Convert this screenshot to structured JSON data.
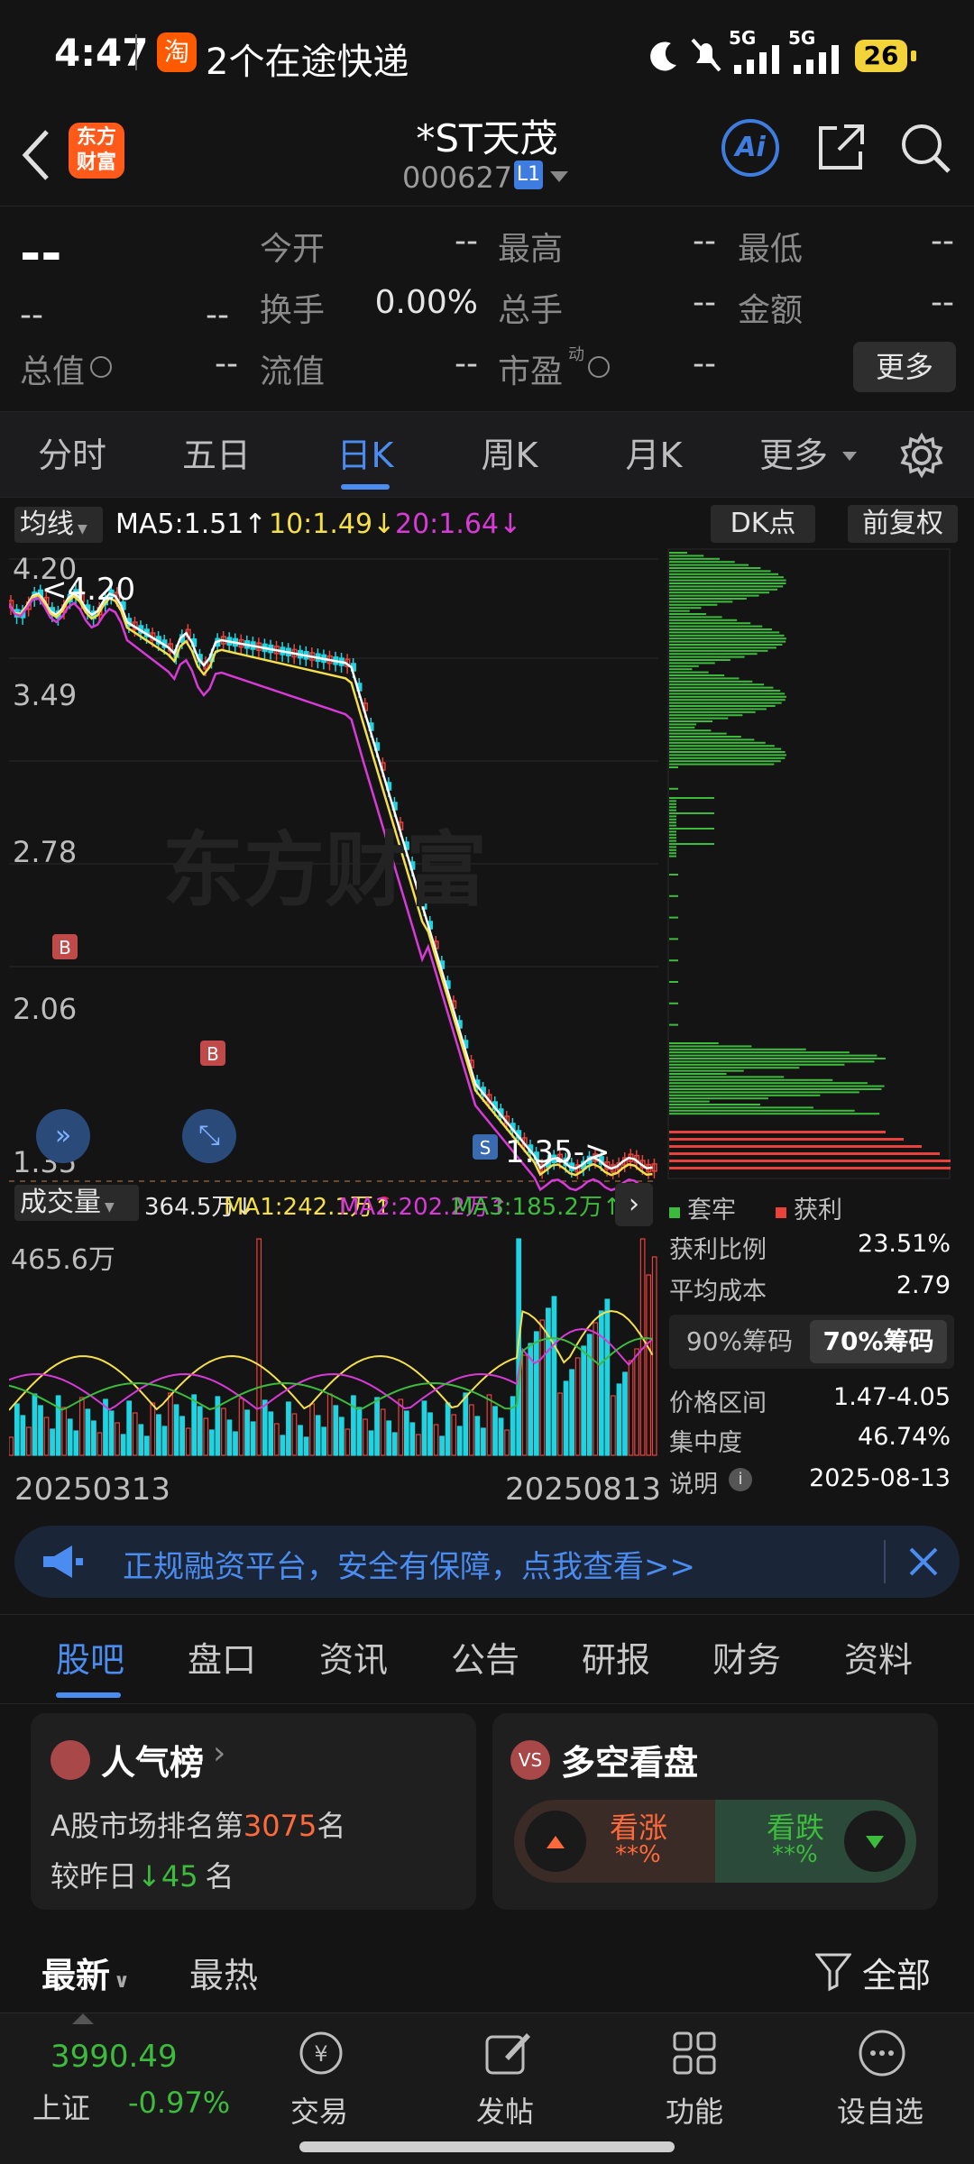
{
  "status": {
    "time": "4:47",
    "notification": "2个在途快递",
    "taobao_badge": "淘",
    "signal1": "5G",
    "signal2": "5G",
    "battery": "26"
  },
  "nav": {
    "logo_line1": "东方",
    "logo_line2": "财富",
    "stock_name": "*ST天茂",
    "stock_code": "000627",
    "level": "L1",
    "ai": "Ai"
  },
  "quote": {
    "price": "--",
    "chg": "--",
    "chg_pct": "--",
    "fields": [
      {
        "label": "今开",
        "value": "--"
      },
      {
        "label": "最高",
        "value": "--"
      },
      {
        "label": "最低",
        "value": "--"
      },
      {
        "label": "换手",
        "value": "0.00%"
      },
      {
        "label": "总手",
        "value": "--"
      },
      {
        "label": "金额",
        "value": "--"
      },
      {
        "label": "总值",
        "value": "--"
      },
      {
        "label": "流值",
        "value": "--"
      },
      {
        "label": "市盈",
        "value": "--"
      }
    ],
    "pe_sup": "动",
    "more": "更多"
  },
  "ktabs": [
    "分时",
    "五日",
    "日K",
    "周K",
    "月K",
    "更多"
  ],
  "ma": {
    "selector": "均线",
    "ma5": "MA5:1.51",
    "ma10": "10:1.49",
    "ma20": "20:1.64",
    "dk": "DK点",
    "fq": "前复权"
  },
  "price_axis": [
    "4.20",
    "3.49",
    "2.78",
    "2.06",
    "1.35"
  ],
  "max_label": "<4.20",
  "min_label": "1.35->",
  "watermark": "东方财富",
  "vol": {
    "selector": "成交量",
    "value": "364.5万",
    "ma1": "MA1:242.1万",
    "ma2": "MA2:202.2万",
    "ma3": "MA3:185.2万",
    "max": "465.6万",
    "date_start": "20250313",
    "date_end": "20250813"
  },
  "chips": {
    "legend_trap": "套牢",
    "legend_profit": "获利",
    "rows": [
      {
        "label": "获利比例",
        "value": "23.51%"
      },
      {
        "label": "平均成本",
        "value": "2.79"
      }
    ],
    "btn90": "90%筹码",
    "btn70": "70%筹码",
    "rows2": [
      {
        "label": "价格区间",
        "value": "1.47-4.05"
      },
      {
        "label": "集中度",
        "value": "46.74%"
      },
      {
        "label": "说明",
        "value": "2025-08-13"
      }
    ]
  },
  "banner": "正规融资平台，安全有保障，点我查看>>",
  "subtabs": [
    "股吧",
    "盘口",
    "资讯",
    "公告",
    "研报",
    "财务",
    "资料"
  ],
  "card_rank": {
    "title": "人气榜",
    "line1_prefix": "A股市场排名第",
    "rank": "3075",
    "line1_suffix": "名",
    "line2_prefix": "较昨日",
    "change": "45",
    "line2_suffix": "名"
  },
  "card_vote": {
    "title": "多空看盘",
    "up": "看涨",
    "up_pct": "**%",
    "down": "看跌",
    "down_pct": "**%"
  },
  "feed": {
    "latest": "最新",
    "hot": "最热",
    "filter": "全部"
  },
  "bottom": {
    "index_value": "3990.49",
    "index_name": "上证",
    "index_chg": "-0.97%",
    "items": [
      "交易",
      "发帖",
      "功能",
      "设自选"
    ]
  },
  "colors": {
    "up": "#e8423d",
    "down": "#1fd4e0",
    "accent": "#4b8cf0",
    "ma5": "#ffffff",
    "ma10": "#f5e04a",
    "ma20": "#d83ad8",
    "green": "#3dbb3d"
  }
}
